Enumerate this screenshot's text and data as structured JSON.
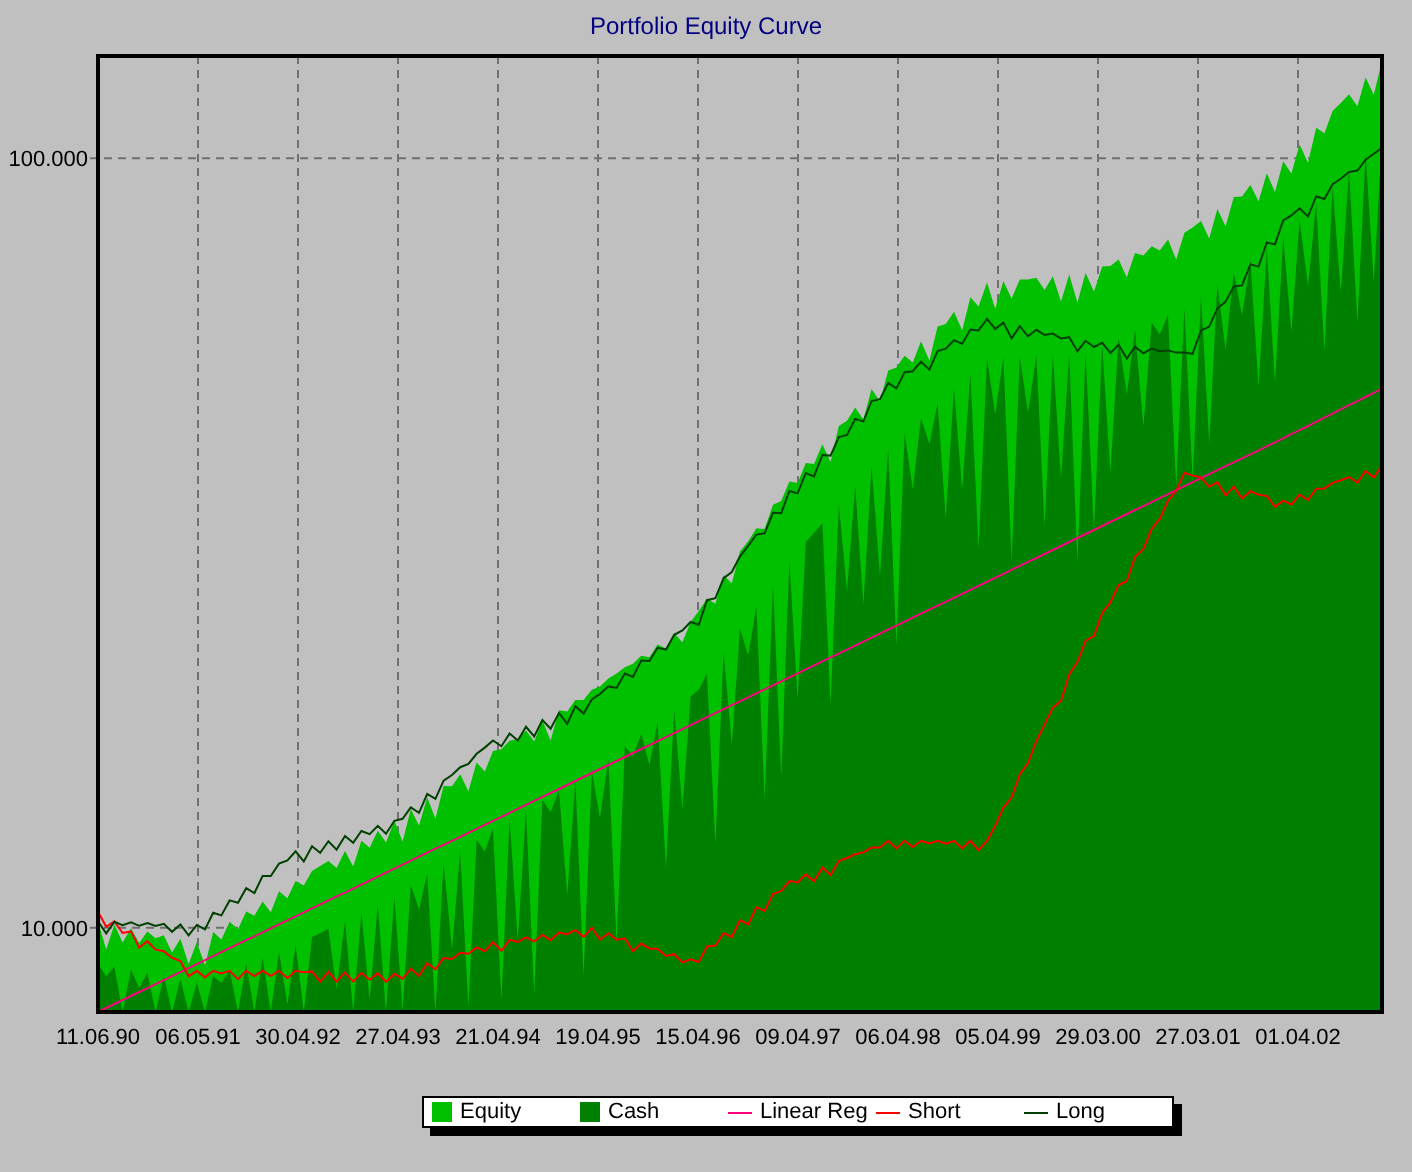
{
  "chart": {
    "title": "Portfolio Equity Curve",
    "y_axis_labels": [
      "100.000",
      "10.000"
    ],
    "x_axis_labels": [
      "11.06.90",
      "06.05.91",
      "30.04.92",
      "27.04.93",
      "21.04.94",
      "19.04.95",
      "15.04.96",
      "09.04.97",
      "06.04.98",
      "05.04.99",
      "29.03.00",
      "27.03.01",
      "01.04.02"
    ],
    "legend": [
      {
        "label": "Equity",
        "kind": "swatch",
        "color": "#00c000"
      },
      {
        "label": "Cash",
        "kind": "swatch",
        "color": "#008000"
      },
      {
        "label": "Linear Reg",
        "kind": "line",
        "color": "#ff0080"
      },
      {
        "label": "Short",
        "kind": "line",
        "color": "#ff0000"
      },
      {
        "label": "Long",
        "kind": "line",
        "color": "#004000"
      }
    ]
  }
}
